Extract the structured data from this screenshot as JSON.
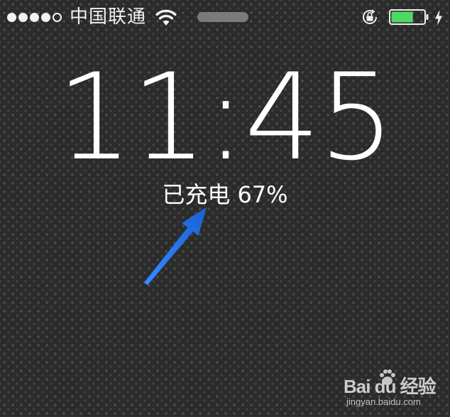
{
  "status_bar": {
    "signal_filled": 4,
    "signal_total": 5,
    "carrier": "中国联通",
    "battery_level": 0.67,
    "battery_color": "#4cd964",
    "charging": true
  },
  "lock_screen": {
    "time": "11:45",
    "charging_label": "已充电",
    "charging_percent": "67%"
  },
  "annotation": {
    "arrow_color": "#1e6fe0"
  },
  "watermark": {
    "logo": "Bai du 经验",
    "url": "jingyan.baidu.com"
  }
}
